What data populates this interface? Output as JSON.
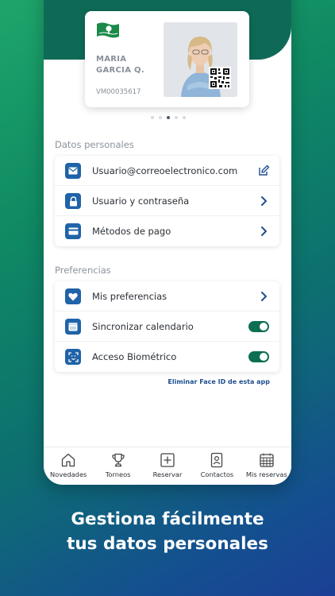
{
  "card": {
    "name_line1": "MARIA",
    "name_line2": "GARCIA Q.",
    "member_id": "VM00035617"
  },
  "personal": {
    "title": "Datos personales",
    "items": [
      {
        "label": "Usuario@correoelectronico.com",
        "icon": "mail-icon",
        "action": "edit-icon"
      },
      {
        "label": "Usuario y contraseña",
        "icon": "lock-icon",
        "action": "chevron-right-icon"
      },
      {
        "label": "Métodos de pago",
        "icon": "card-icon",
        "action": "chevron-right-icon"
      }
    ]
  },
  "preferences": {
    "title": "Preferencias",
    "items": [
      {
        "label": "Mis preferencias",
        "icon": "heart-icon",
        "action": "chevron-right-icon"
      },
      {
        "label": "Sincronizar calendario",
        "icon": "calendar-icon",
        "toggle": true
      },
      {
        "label": "Acceso Biométrico",
        "icon": "face-id-icon",
        "toggle": true
      }
    ]
  },
  "remove_face_id": "Eliminar Face ID de esta app",
  "nav": [
    {
      "label": "Novedades",
      "icon": "home-icon"
    },
    {
      "label": "Torneos",
      "icon": "trophy-icon"
    },
    {
      "label": "Reservar",
      "icon": "plus-square-icon"
    },
    {
      "label": "Contactos",
      "icon": "contacts-icon"
    },
    {
      "label": "Mis reservas",
      "icon": "calendar-grid-icon"
    }
  ],
  "headline": {
    "line1": "Gestiona fácilmente",
    "line2": "tus datos personales"
  },
  "colors": {
    "brand_green": "#0e6a57",
    "icon_blue": "#1f63a8",
    "toggle_on": "#0d6e52"
  }
}
